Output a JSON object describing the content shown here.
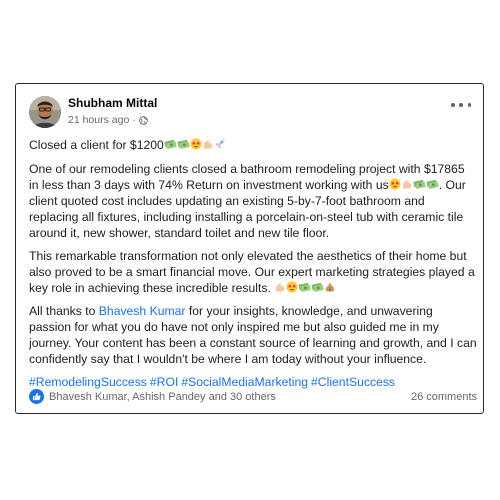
{
  "post": {
    "author": "Shubham Mittal",
    "time": "21 hours ago ·",
    "intro": "Closed a client for $1200",
    "p1_text": "One of our remodeling clients closed a bathroom remodeling project with $17865 in less than 3 days with 74% Return on investment working with us",
    "p1_after": ". Our client quoted cost includes updating an existing 5-by-7-foot bathroom and replacing all fixtures, including installing a porcelain-on-steel tub with ceramic tile around it, new shower, standard toilet and new tile floor.",
    "p2_text": "This remarkable transformation not only elevated the aesthetics of their home but also proved to be a smart financial move. Our expert marketing strategies played a key role in achieving these incredible results.",
    "p3_before": "All thanks to ",
    "p3_mention": "Bhavesh Kumar",
    "p3_after": " for your insights, knowledge, and unwavering passion for what you do have not only inspired me but also guided me in my journey. Your content has been a constant source of learning and growth, and I can confidently say that I wouldn't be where I am today without your influence.",
    "hashtags": [
      "#RemodelingSuccess",
      "#ROI",
      "#SocialMediaMarketing",
      "#ClientSuccess"
    ],
    "reactions": "Bhavesh Kumar, Ashish Pandey and 30 others",
    "comments": "26 comments"
  },
  "icons": {
    "avatar": "profile-photo",
    "globe": "globe-icon",
    "more": "ellipsis-icon",
    "like": "thumbs-up-icon",
    "emoji_sequence_1": [
      "money-with-wings",
      "money-with-wings",
      "star-struck",
      "flexed-biceps",
      "rocket"
    ],
    "emoji_sequence_2": [
      "star-struck",
      "flexed-biceps",
      "money-with-wings",
      "money-with-wings"
    ],
    "emoji_sequence_3": [
      "flexed-biceps",
      "star-struck",
      "money-with-wings",
      "money-with-wings",
      "money-bag"
    ]
  },
  "colors": {
    "link": "#1b74e4",
    "secondary_text": "#65676b",
    "primary_text": "#1c1e21"
  }
}
